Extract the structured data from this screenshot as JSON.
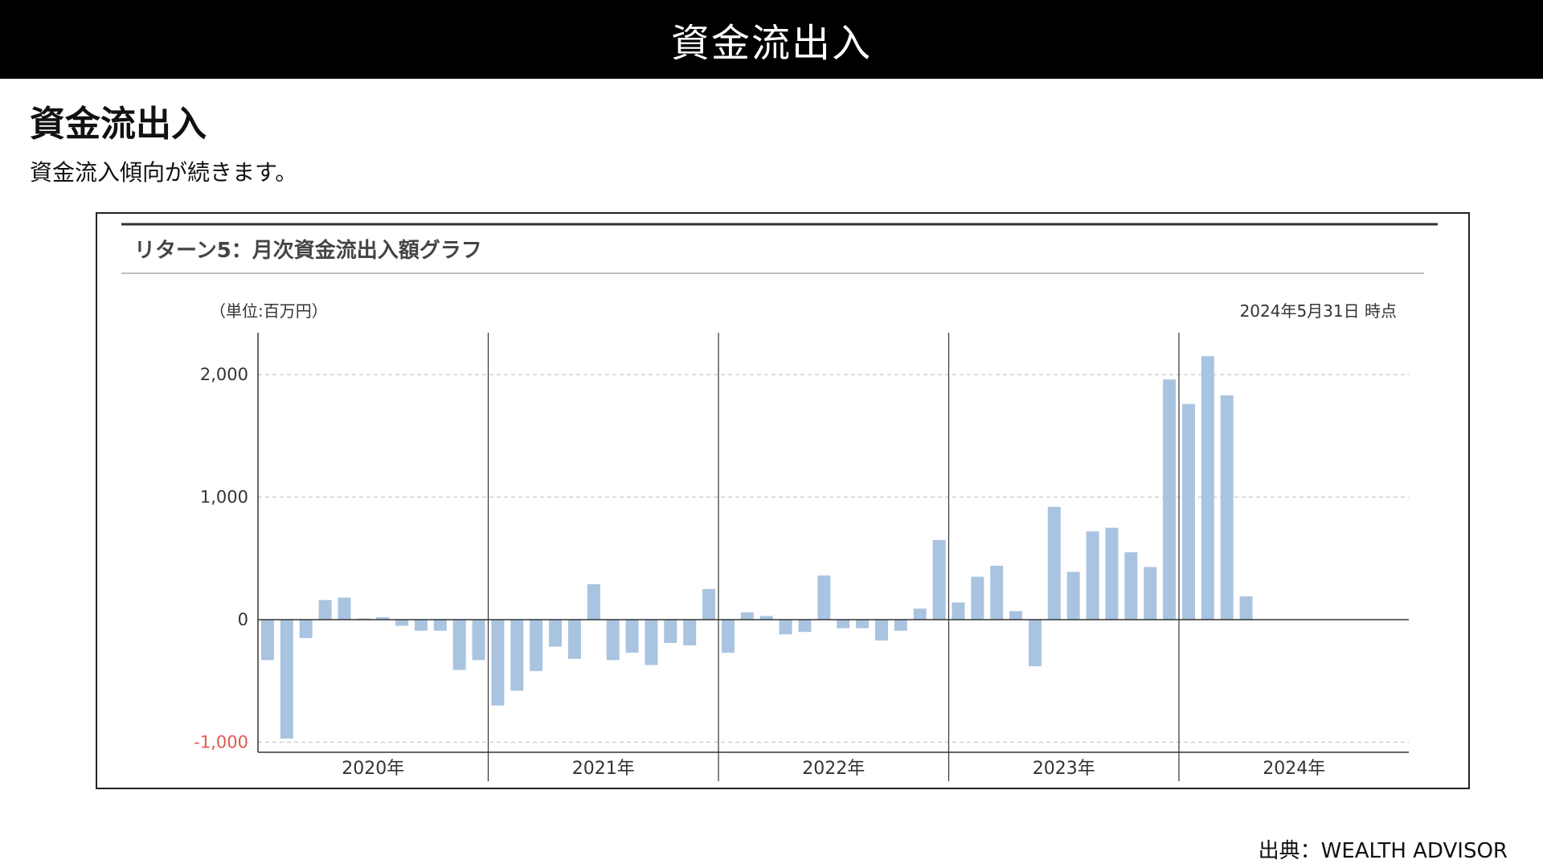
{
  "header": {
    "title": "資金流出入"
  },
  "section": {
    "heading": "資金流出入",
    "description": "資金流入傾向が続きます。"
  },
  "chart_panel": {
    "title": "リターン5：月次資金流出入額グラフ",
    "unit_note": "（単位:百万円）",
    "as_of": "2024年5月31日 時点"
  },
  "source": "出典：WEALTH ADVISOR",
  "colors": {
    "bar": "#a9c4e0",
    "negative_tick": "#e05a4f",
    "grid": "#c8c8c8",
    "axis": "#333333"
  },
  "chart_data": {
    "type": "bar",
    "title": "リターン5：月次資金流出入額グラフ",
    "ylabel": "（単位:百万円）",
    "ylim": [
      -1050,
      2350
    ],
    "yticks": [
      {
        "value": 2000,
        "label": "2,000"
      },
      {
        "value": 1000,
        "label": "1,000"
      },
      {
        "value": 0,
        "label": "0"
      },
      {
        "value": -1000,
        "label": "-1,000"
      }
    ],
    "grid": true,
    "years": [
      "2020年",
      "2021年",
      "2022年",
      "2023年",
      "2024年"
    ],
    "series": [
      {
        "values": [
          -330,
          -970,
          -150,
          160,
          180,
          10,
          20,
          -50,
          -90,
          -90,
          -410,
          -330,
          -700,
          -580,
          -420,
          -220,
          -320,
          290,
          -330,
          -270,
          -370,
          -190,
          -210,
          250,
          -270,
          60,
          30,
          -120,
          -100,
          360,
          -70,
          -70,
          -170,
          -90,
          90,
          650,
          140,
          350,
          440,
          70,
          -380,
          920,
          390,
          720,
          750,
          550,
          430,
          1960,
          1760,
          2150,
          1830,
          190
        ]
      }
    ]
  }
}
